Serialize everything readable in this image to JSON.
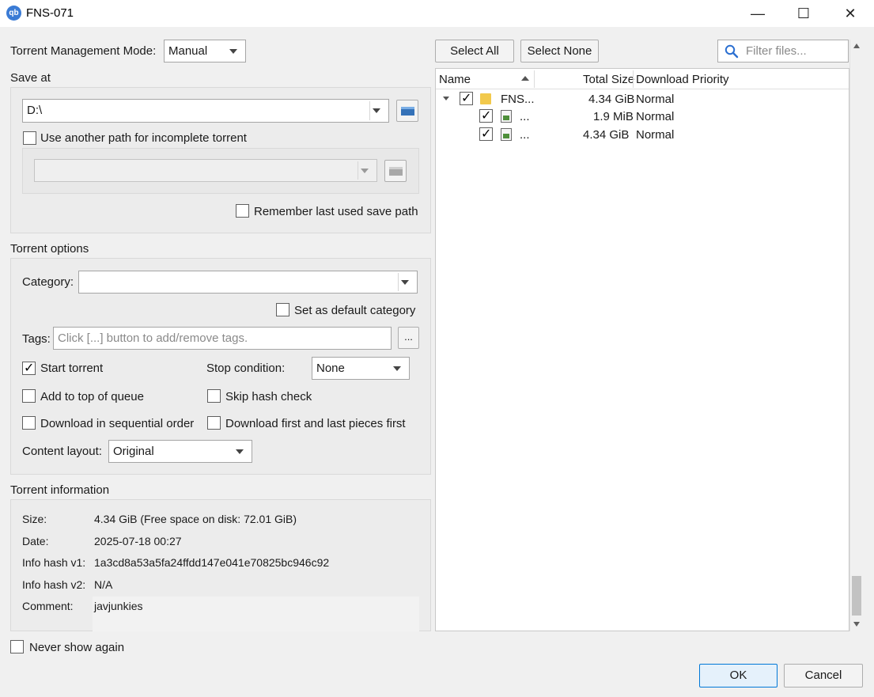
{
  "window": {
    "title": "FNS-071",
    "app_icon": "qb",
    "minimize": "—",
    "maximize": "☐",
    "close": "✕"
  },
  "mgmt": {
    "label": "Torrent Management Mode:",
    "value": "Manual"
  },
  "save": {
    "group_label": "Save at",
    "path": "D:\\",
    "incomplete_label": "Use another path for incomplete torrent",
    "incomplete_checked": false,
    "incomplete_path": "",
    "remember_label": "Remember last used save path",
    "remember_checked": false
  },
  "options": {
    "group_label": "Torrent options",
    "category_label": "Category:",
    "category_value": "",
    "default_category_label": "Set as default category",
    "tags_label": "Tags:",
    "tags_placeholder": "Click [...] button to add/remove tags.",
    "tags_button": "...",
    "start_label": "Start torrent",
    "start_checked": true,
    "stop_label": "Stop condition:",
    "stop_value": "None",
    "top_queue_label": "Add to top of queue",
    "skip_hash_label": "Skip hash check",
    "sequential_label": "Download in sequential order",
    "first_last_label": "Download first and last pieces first",
    "layout_label": "Content layout:",
    "layout_value": "Original"
  },
  "info": {
    "group_label": "Torrent information",
    "size_label": "Size:",
    "size_value": "4.34 GiB (Free space on disk: 72.01 GiB)",
    "date_label": "Date:",
    "date_value": "2025-07-18 00:27",
    "hash1_label": "Info hash v1:",
    "hash1_value": "1a3cd8a53a5fa24ffdd147e041e70825bc946c92",
    "hash2_label": "Info hash v2:",
    "hash2_value": "N/A",
    "comment_label": "Comment:",
    "comment_value": "javjunkies"
  },
  "never_show": "Never show again",
  "files": {
    "select_all": "Select All",
    "select_none": "Select None",
    "filter_placeholder": "Filter files...",
    "col_name": "Name",
    "col_size": "Total Size",
    "col_priority": "Download Priority",
    "rows": [
      {
        "name": "FNS...",
        "size": "4.34 GiB",
        "priority": "Normal",
        "type": "folder",
        "checked": true
      },
      {
        "name": "...",
        "size": "1.9 MiB",
        "priority": "Normal",
        "type": "file",
        "checked": true
      },
      {
        "name": "...",
        "size": "4.34 GiB",
        "priority": "Normal",
        "type": "file",
        "checked": true
      }
    ]
  },
  "buttons": {
    "ok": "OK",
    "cancel": "Cancel"
  }
}
